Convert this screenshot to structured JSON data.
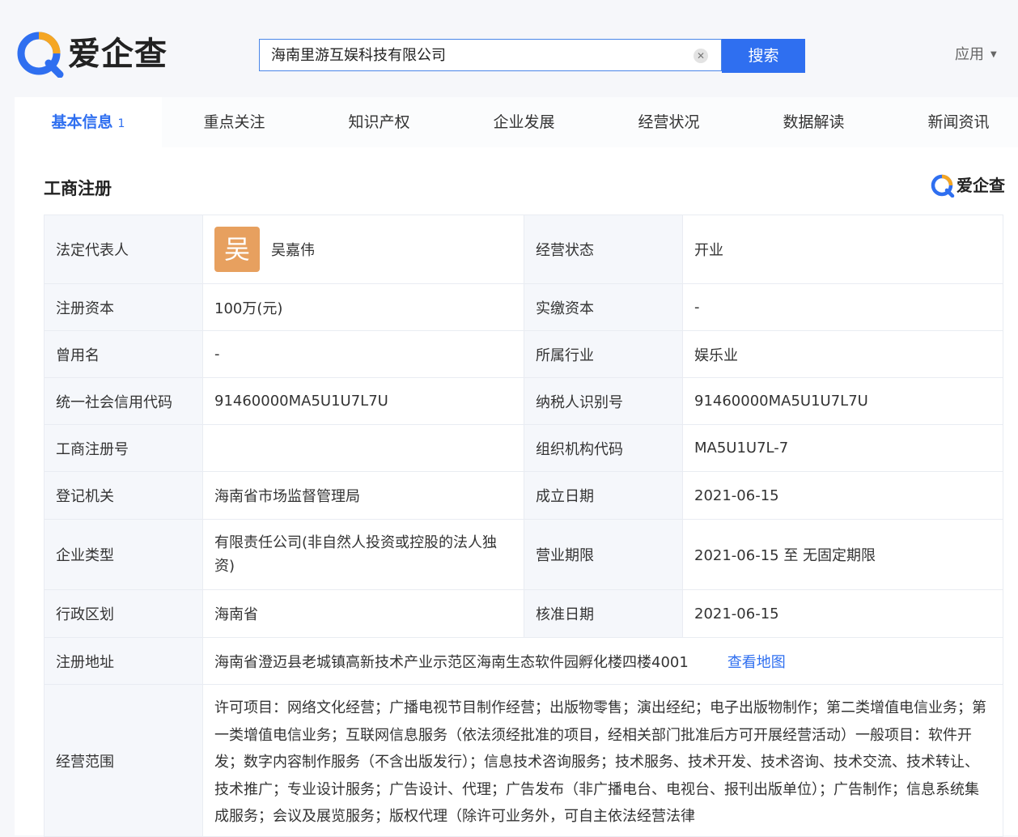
{
  "brand": {
    "name": "爱企查"
  },
  "search": {
    "query": "海南里游互娱科技有限公司",
    "button": "搜索"
  },
  "header": {
    "apps_label": "应用"
  },
  "tabs": [
    {
      "label": "基本信息",
      "count": "1"
    },
    {
      "label": "重点关注"
    },
    {
      "label": "知识产权"
    },
    {
      "label": "企业发展"
    },
    {
      "label": "经营状况"
    },
    {
      "label": "数据解读"
    },
    {
      "label": "新闻资讯"
    }
  ],
  "section": {
    "title": "工商注册"
  },
  "info": {
    "legal_rep_label": "法定代表人",
    "legal_rep_avatar": "吴",
    "legal_rep": "吴嘉伟",
    "status_label": "经营状态",
    "status": "开业",
    "reg_capital_label": "注册资本",
    "reg_capital": "100万(元)",
    "paid_capital_label": "实缴资本",
    "paid_capital": "-",
    "former_name_label": "曾用名",
    "former_name": "-",
    "industry_label": "所属行业",
    "industry": "娱乐业",
    "credit_code_label": "统一社会信用代码",
    "credit_code": "91460000MA5U1U7L7U",
    "taxpayer_id_label": "纳税人识别号",
    "taxpayer_id": "91460000MA5U1U7L7U",
    "reg_no_label": "工商注册号",
    "reg_no": "",
    "org_code_label": "组织机构代码",
    "org_code": "MA5U1U7L-7",
    "authority_label": "登记机关",
    "authority": "海南省市场监督管理局",
    "founded_label": "成立日期",
    "founded": "2021-06-15",
    "company_type_label": "企业类型",
    "company_type": "有限责任公司(非自然人投资或控股的法人独资)",
    "term_label": "营业期限",
    "term": "2021-06-15 至 无固定期限",
    "region_label": "行政区划",
    "region": "海南省",
    "approved_label": "核准日期",
    "approved": "2021-06-15",
    "address_label": "注册地址",
    "address": "海南省澄迈县老城镇高新技术产业示范区海南生态软件园孵化楼四楼4001",
    "map_link": "查看地图",
    "scope_label": "经营范围",
    "scope": "许可项目：网络文化经营；广播电视节目制作经营；出版物零售；演出经纪；电子出版物制作；第二类增值电信业务；第一类增值电信业务；互联网信息服务（依法须经批准的项目，经相关部门批准后方可开展经营活动）一般项目：软件开发；数字内容制作服务（不含出版发行）；信息技术咨询服务；技术服务、技术开发、技术咨询、技术交流、技术转让、技术推广；专业设计服务；广告设计、代理；广告发布（非广播电台、电视台、报刊出版单位）；广告制作；信息系统集成服务；会议及展览服务；版权代理（除许可业务外，可自主依法经营法律"
  },
  "colors": {
    "accent": "#2f6ff0",
    "logo_orange": "#f5a623",
    "avatar": "#e7a05f"
  },
  "icons": [
    "search-logo-icon",
    "clear-icon",
    "chevron-down-icon"
  ]
}
